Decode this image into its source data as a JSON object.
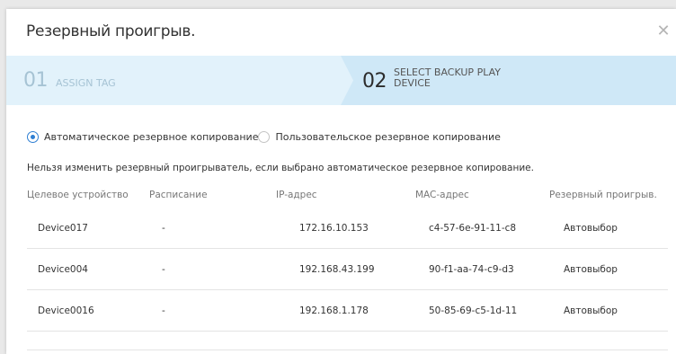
{
  "dialog": {
    "title": "Резервный проигрыв.",
    "close_icon": "close-icon"
  },
  "steps": [
    {
      "number": "01",
      "label": "ASSIGN TAG",
      "state": "done"
    },
    {
      "number": "02",
      "label": "SELECT BACKUP PLAY DEVICE",
      "state": "active"
    }
  ],
  "colors": {
    "step_inactive_bg": "#e2f2fb",
    "step_active_bg": "#cfe8f7",
    "accent": "#2f7fd3"
  },
  "backup_mode": {
    "options": [
      {
        "label": "Автоматическое резервное копирование",
        "selected": true
      },
      {
        "label": "Пользовательское резервное копирование",
        "selected": false
      }
    ]
  },
  "note": "Нельзя изменить резервный проигрыватель, если выбрано автоматическое резервное копирование.",
  "table": {
    "headers": [
      "Целевое устройство",
      "Расписание",
      "IP-адрес",
      "MAC-адрес",
      "Резервный проигрыв."
    ],
    "rows": [
      [
        "Device017",
        "-",
        "172.16.10.153",
        "c4-57-6e-91-11-c8",
        "Автовыбор"
      ],
      [
        "Device004",
        "-",
        "192.168.43.199",
        "90-f1-aa-74-c9-d3",
        "Автовыбор"
      ],
      [
        "Device0016",
        "-",
        "192.168.1.178",
        "50-85-69-c5-1d-11",
        "Автовыбор"
      ]
    ]
  }
}
